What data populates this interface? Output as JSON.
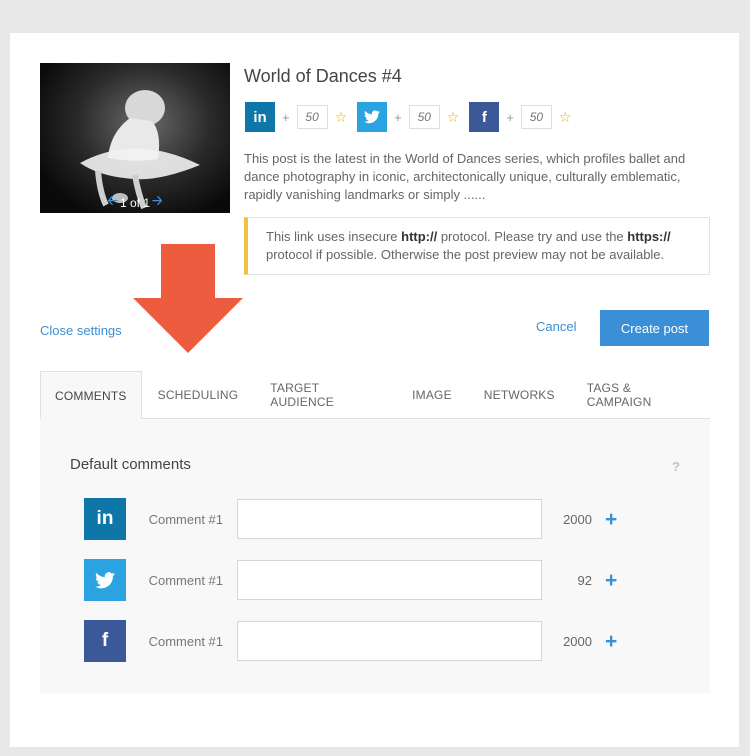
{
  "post": {
    "title": "World of Dances #4",
    "description": "This post is the latest in the World of Dances series, which profiles ballet and dance photography in iconic, architectonically unique, culturally emblematic, rapidly vanishing landmarks or simply ......",
    "image_counter": "1 of 1"
  },
  "networks": [
    {
      "name": "linkedin",
      "icon": "linkedin-icon",
      "glyph": "in",
      "color": "#0e76a8",
      "count_placeholder": "50"
    },
    {
      "name": "twitter",
      "icon": "twitter-icon",
      "glyph": "t",
      "color": "#2aa3e0",
      "count_placeholder": "50"
    },
    {
      "name": "facebook",
      "icon": "facebook-icon",
      "glyph": "f",
      "color": "#3b5998",
      "count_placeholder": "50"
    }
  ],
  "warning": {
    "text_before": "This link uses insecure ",
    "http": "http://",
    "text_middle": " protocol. Please try and use the ",
    "https": "https://",
    "text_after": " protocol if possible. Otherwise the post preview may not be available."
  },
  "actions": {
    "close_settings": "Close settings",
    "cancel": "Cancel",
    "create_post": "Create post"
  },
  "tabs": [
    {
      "label": "COMMENTS",
      "active": true
    },
    {
      "label": "SCHEDULING",
      "active": false
    },
    {
      "label": "TARGET AUDIENCE",
      "active": false
    },
    {
      "label": "IMAGE",
      "active": false
    },
    {
      "label": "NETWORKS",
      "active": false
    },
    {
      "label": "TAGS & CAMPAIGN",
      "active": false
    }
  ],
  "comments_panel": {
    "title": "Default comments",
    "help": "?",
    "rows": [
      {
        "network": "linkedin",
        "label": "Comment #1",
        "value": "",
        "remaining": "2000"
      },
      {
        "network": "twitter",
        "label": "Comment #1",
        "value": "",
        "remaining": "92"
      },
      {
        "network": "facebook",
        "label": "Comment #1",
        "value": "",
        "remaining": "2000"
      }
    ],
    "add_symbol": "+"
  },
  "colors": {
    "accent": "#3a8fd6",
    "warning_border": "#f0c040",
    "arrow": "#ee5c40",
    "star": "#f0a500"
  }
}
